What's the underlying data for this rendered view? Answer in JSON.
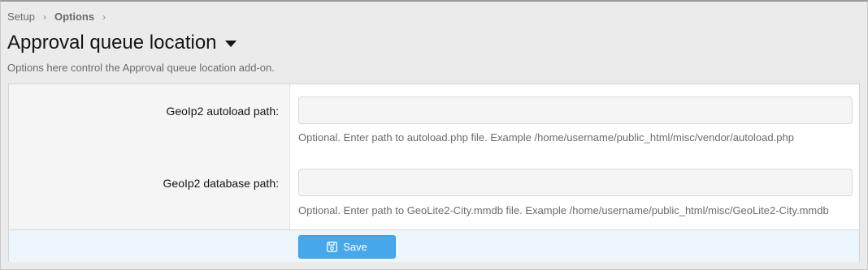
{
  "breadcrumb": {
    "items": [
      "Setup",
      "Options"
    ],
    "separator": "›"
  },
  "page": {
    "title": "Approval queue location",
    "description": "Options here control the Approval queue location add-on."
  },
  "form": {
    "fields": [
      {
        "label": "GeoIp2 autoload path:",
        "value": "",
        "placeholder": "",
        "hint": "Optional. Enter path to autoload.php file. Example /home/username/public_html/misc/vendor/autoload.php"
      },
      {
        "label": "GeoIp2 database path:",
        "value": "",
        "placeholder": "",
        "hint": "Optional. Enter path to GeoLite2-City.mmdb file. Example /home/username/public_html/misc/GeoLite2-City.mmdb"
      }
    ],
    "save_label": "Save",
    "save_icon": "save-icon"
  },
  "colors": {
    "button": "#47a7eb",
    "submit_row": "#edf6fd",
    "label_column": "#f5f5f5"
  }
}
